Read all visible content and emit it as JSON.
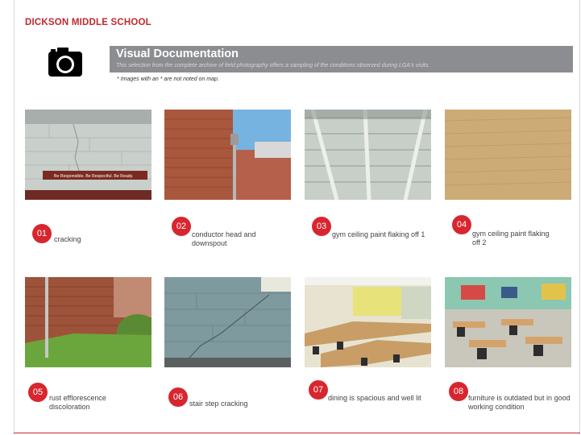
{
  "header": {
    "school": "DICKSON MIDDLE SCHOOL"
  },
  "banner": {
    "title": "Visual Documentation",
    "subtitle": "This selection from the complete archive of field photography offers a sampling of the conditions observed during LGA's visits.",
    "note": "* Images with an * are not noted on map."
  },
  "icons": {
    "camera": "camera-icon"
  },
  "colors": {
    "accent": "#d8262e",
    "banner": "#8c8d90"
  },
  "photos": [
    {
      "number": "01",
      "caption": "cracking"
    },
    {
      "number": "02",
      "caption": "conductor head and downspout"
    },
    {
      "number": "03",
      "caption": "gym ceiling paint flaking off 1"
    },
    {
      "number": "04",
      "caption": "gym ceiling paint flaking off 2"
    },
    {
      "number": "05",
      "caption": "rust efflorescence discoloration"
    },
    {
      "number": "06",
      "caption": "stair step cracking"
    },
    {
      "number": "07",
      "caption": "dining is spacious and well lit"
    },
    {
      "number": "08",
      "caption": "furniture is outdated but in good working condition"
    }
  ],
  "sign": {
    "text": "Be Responsible. Be Respectful. Be Ready."
  }
}
